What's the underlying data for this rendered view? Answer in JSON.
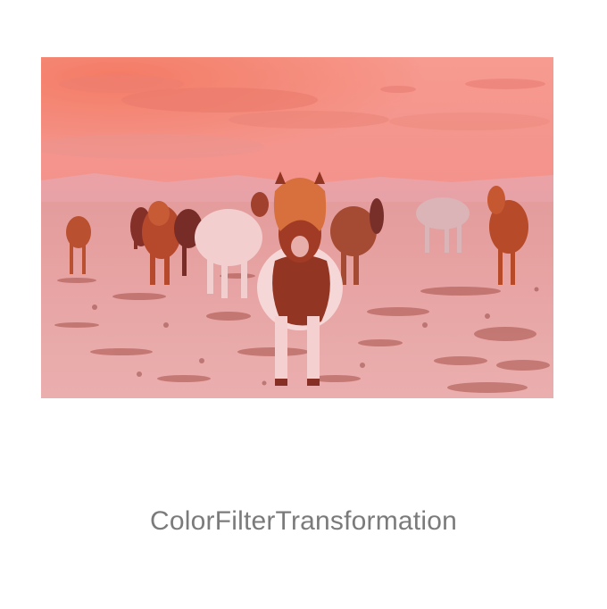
{
  "image": {
    "alt": "Horses on a snowy field at sunset with a red color filter",
    "tint_color": "#ff5a5a",
    "subject": "horses-in-snow"
  },
  "caption": {
    "text": "ColorFilterTransformation"
  },
  "colors": {
    "background": "#ffffff",
    "caption_text": "#7b7b7b",
    "sky_top": "#f59a8f",
    "sky_glow": "#f07f6f",
    "ground": "#e9b3b3"
  }
}
